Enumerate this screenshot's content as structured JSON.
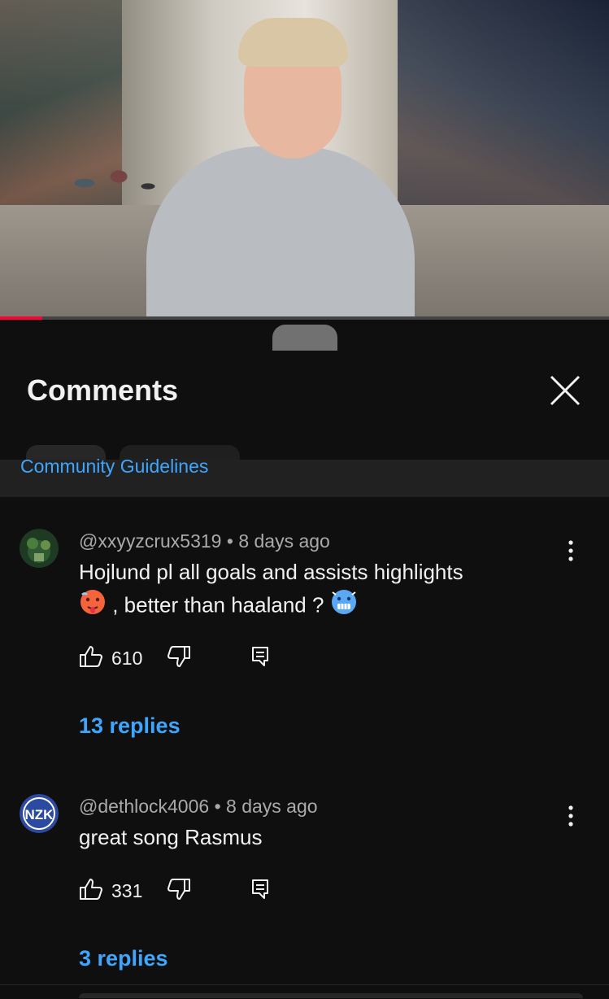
{
  "video": {
    "progress": 0.07,
    "accent": "#ff0033"
  },
  "panel": {
    "title": "Comments",
    "guidelines_link": "Community Guidelines"
  },
  "comments": [
    {
      "author": "@xxyyzcrux5319",
      "separator": "•",
      "time": "8 days ago",
      "text_line1": "Hojlund pl all goals and assists highlights",
      "text_line2": ", better than haaland ?",
      "emoji1": "hot-face",
      "emoji2": "cold-face",
      "likes": "610",
      "replies": "13 replies"
    },
    {
      "author": "@dethlock4006",
      "separator": "•",
      "time": "8 days ago",
      "text_line1": "great song Rasmus",
      "avatar_text": "NZK",
      "likes": "331",
      "replies": "3 replies"
    }
  ],
  "colors": {
    "link": "#3ea6ff",
    "background": "#0f0f0f",
    "muted": "#aaaaaa"
  }
}
